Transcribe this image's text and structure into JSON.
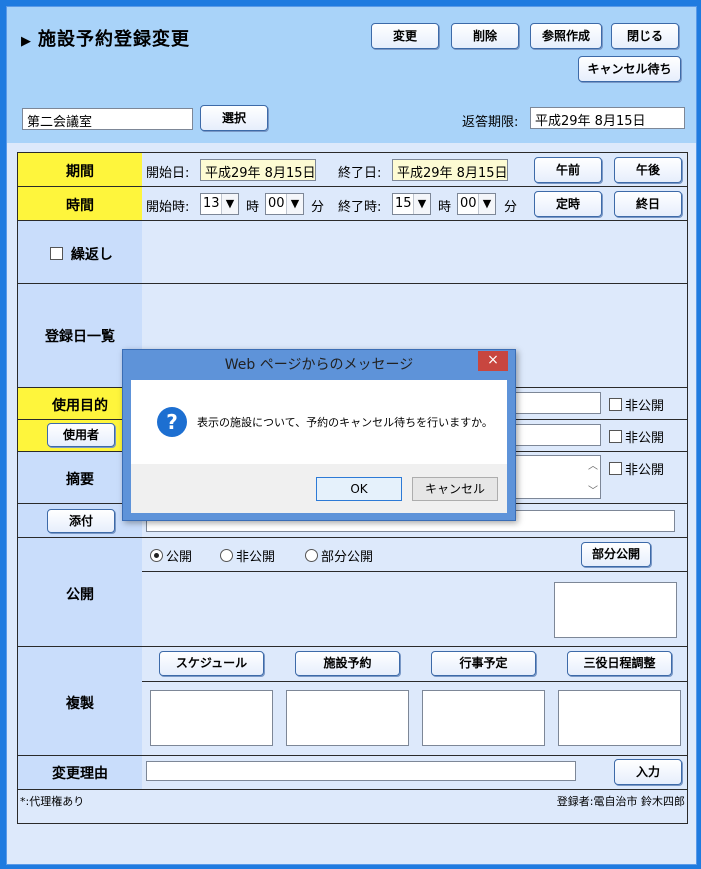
{
  "header": {
    "title": "施設予約登録変更",
    "buttons": {
      "change": "変更",
      "delete": "削除",
      "reference_create": "参照作成",
      "close": "閉じる",
      "cancel_wait": "キャンセル待ち"
    },
    "facility_value": "第二会議室",
    "select_button": "選択",
    "reply_deadline_label": "返答期限:",
    "reply_deadline_value": "平成29年 8月15日"
  },
  "period": {
    "label": "期間",
    "start_label": "開始日:",
    "start_value": "平成29年 8月15日",
    "end_label": "終了日:",
    "end_value": "平成29年 8月15日",
    "am_button": "午前",
    "pm_button": "午後"
  },
  "time": {
    "label": "時間",
    "start_label": "開始時:",
    "start_hour": "13",
    "start_min": "00",
    "end_label": "終了時:",
    "end_hour": "15",
    "end_min": "00",
    "hour_unit": "時",
    "min_unit": "分",
    "regular_button": "定時",
    "allday_button": "終日"
  },
  "repeat": {
    "label": "繰返し",
    "checked": false
  },
  "date_list": {
    "label": "登録日一覧"
  },
  "purpose": {
    "label": "使用目的",
    "private_label": "非公開"
  },
  "user": {
    "button": "使用者",
    "private_label": "非公開"
  },
  "summary": {
    "label": "摘要",
    "private_label": "非公開"
  },
  "attach": {
    "button": "添付"
  },
  "publish": {
    "label": "公開",
    "options": [
      "公開",
      "非公開",
      "部分公開"
    ],
    "selected": "公開",
    "partial_button": "部分公開"
  },
  "copy": {
    "label": "複製",
    "buttons": [
      "スケジュール",
      "施設予約",
      "行事予定",
      "三役日程調整"
    ]
  },
  "change_reason": {
    "label": "変更理由",
    "input_button": "入力"
  },
  "footer": {
    "note": "*:代理権あり",
    "registrant": "登録者:電自治市 鈴木四郎"
  },
  "dialog": {
    "title": "Web ページからのメッセージ",
    "close_glyph": "×",
    "icon_glyph": "?",
    "message": "表示の施設について、予約のキャンセル待ちを行いますか。",
    "ok": "OK",
    "cancel": "キャンセル"
  }
}
